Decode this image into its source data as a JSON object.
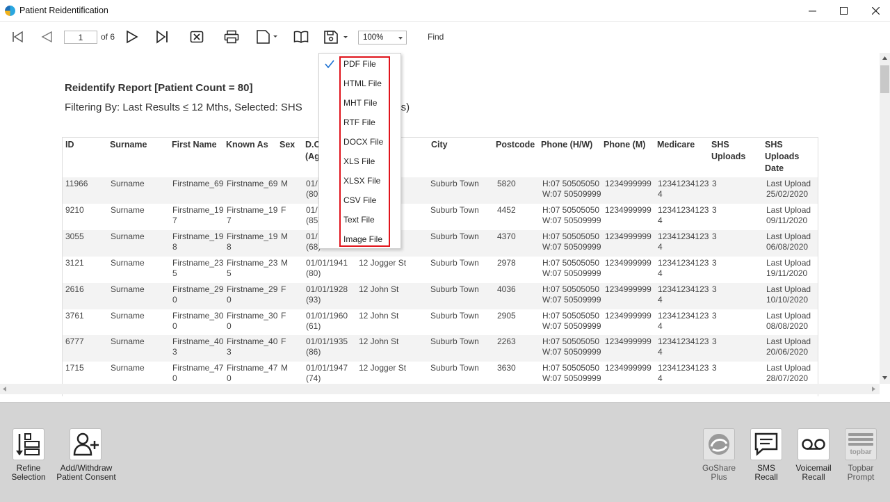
{
  "window": {
    "title": "Patient Reidentification",
    "min": "—",
    "max": "☐",
    "close": "✕"
  },
  "toolbar": {
    "page_value": "1",
    "page_of": "of 6",
    "zoom_value": "100%",
    "find_label": "Find"
  },
  "report": {
    "title": "Reidentify Report  [Patient Count = 80]",
    "filter": "Filtering By: Last Results ≤ 12 Mths, Selected: SHS",
    "filter_tail": "ads)"
  },
  "table": {
    "headers": [
      {
        "text": "ID"
      },
      {
        "text": "Surname"
      },
      {
        "text": "First Name"
      },
      {
        "text": "Known As"
      },
      {
        "text": "Sex"
      },
      {
        "text": "D.O",
        "line2": "(Ag"
      },
      {
        "text": ""
      },
      {
        "text": "City"
      },
      {
        "text": "Postcode"
      },
      {
        "text": "Phone (H/W)"
      },
      {
        "text": "Phone (M)"
      },
      {
        "text": "Medicare"
      },
      {
        "text": "SHS",
        "line2": "Uploads"
      },
      {
        "text": "SHS",
        "line2": "Uploads",
        "line3": "Date"
      }
    ],
    "rows": [
      {
        "id": "11966",
        "surname": "Surname",
        "first1": "Firstname_69",
        "first2": "",
        "known1": "Firstname_69",
        "known2": "",
        "sex": "M",
        "dob1": "01/",
        "dob2": "(80)",
        "addr": "t",
        "city": "Suburb Town",
        "postcode": "5820",
        "ph1": "H:07 50505050",
        "ph2": "W:07 50509999",
        "mob": "1234999999",
        "med1": "12341234123",
        "med2": "4",
        "up": "3",
        "ud1": "Last Upload",
        "ud2": "25/02/2020"
      },
      {
        "id": "9210",
        "surname": "Surname",
        "first1": "Firstname_19",
        "first2": "7",
        "known1": "Firstname_19",
        "known2": "7",
        "sex": "F",
        "dob1": "01/",
        "dob2": "(85)",
        "addr": "",
        "city": "Suburb Town",
        "postcode": "4452",
        "ph1": "H:07 50505050",
        "ph2": "W:07 50509999",
        "mob": "1234999999",
        "med1": "12341234123",
        "med2": "4",
        "up": "3",
        "ud1": "Last Upload",
        "ud2": "09/11/2020"
      },
      {
        "id": "3055",
        "surname": "Surname",
        "first1": "Firstname_19",
        "first2": "8",
        "known1": "Firstname_19",
        "known2": "8",
        "sex": "M",
        "dob1": "01/",
        "dob2": "(68)",
        "addr": "t",
        "city": "Suburb Town",
        "postcode": "4370",
        "ph1": "H:07 50505050",
        "ph2": "W:07 50509999",
        "mob": "1234999999",
        "med1": "12341234123",
        "med2": "4",
        "up": "3",
        "ud1": "Last Upload",
        "ud2": "06/08/2020"
      },
      {
        "id": "3121",
        "surname": "Surname",
        "first1": "Firstname_23",
        "first2": "5",
        "known1": "Firstname_23",
        "known2": "5",
        "sex": "M",
        "dob1": "01/01/1941",
        "dob2": "(80)",
        "addr": "12 Jogger St",
        "city": "Suburb Town",
        "postcode": "2978",
        "ph1": "H:07 50505050",
        "ph2": "W:07 50509999",
        "mob": "1234999999",
        "med1": "12341234123",
        "med2": "4",
        "up": "3",
        "ud1": "Last Upload",
        "ud2": "19/11/2020"
      },
      {
        "id": "2616",
        "surname": "Surname",
        "first1": "Firstname_29",
        "first2": "0",
        "known1": "Firstname_29",
        "known2": "0",
        "sex": "F",
        "dob1": "01/01/1928",
        "dob2": "(93)",
        "addr": "12 John St",
        "city": "Suburb Town",
        "postcode": "4036",
        "ph1": "H:07 50505050",
        "ph2": "W:07 50509999",
        "mob": "1234999999",
        "med1": "12341234123",
        "med2": "4",
        "up": "3",
        "ud1": "Last Upload",
        "ud2": "10/10/2020"
      },
      {
        "id": "3761",
        "surname": "Surname",
        "first1": "Firstname_30",
        "first2": "0",
        "known1": "Firstname_30",
        "known2": "0",
        "sex": "F",
        "dob1": "01/01/1960",
        "dob2": "(61)",
        "addr": "12 John St",
        "city": "Suburb Town",
        "postcode": "2905",
        "ph1": "H:07 50505050",
        "ph2": "W:07 50509999",
        "mob": "1234999999",
        "med1": "12341234123",
        "med2": "4",
        "up": "3",
        "ud1": "Last Upload",
        "ud2": "08/08/2020"
      },
      {
        "id": "6777",
        "surname": "Surname",
        "first1": "Firstname_40",
        "first2": "3",
        "known1": "Firstname_40",
        "known2": "3",
        "sex": "F",
        "dob1": "01/01/1935",
        "dob2": "(86)",
        "addr": "12 John St",
        "city": "Suburb Town",
        "postcode": "2263",
        "ph1": "H:07 50505050",
        "ph2": "W:07 50509999",
        "mob": "1234999999",
        "med1": "12341234123",
        "med2": "4",
        "up": "3",
        "ud1": "Last Upload",
        "ud2": "20/06/2020"
      },
      {
        "id": "1715",
        "surname": "Surname",
        "first1": "Firstname_47",
        "first2": "0",
        "known1": "Firstname_47",
        "known2": "0",
        "sex": "M",
        "dob1": "01/01/1947",
        "dob2": "(74)",
        "addr": "12 Jogger St",
        "city": "Suburb Town",
        "postcode": "3630",
        "ph1": "H:07 50505050",
        "ph2": "W:07 50509999",
        "mob": "1234999999",
        "med1": "12341234123",
        "med2": "4",
        "up": "3",
        "ud1": "Last Upload",
        "ud2": "28/07/2020"
      }
    ]
  },
  "save_menu": {
    "items": [
      "PDF File",
      "HTML File",
      "MHT File",
      "RTF File",
      "DOCX File",
      "XLS File",
      "XLSX File",
      "CSV File",
      "Text File",
      "Image File"
    ],
    "checked_index": 0,
    "highlight_color": "#e0131b"
  },
  "bottom": {
    "buttons": [
      {
        "label1": "Refine",
        "label2": "Selection"
      },
      {
        "label1": "Add/Withdraw",
        "label2": "Patient Consent"
      },
      {
        "label1": "GoShare",
        "label2": "Plus"
      },
      {
        "label1": "SMS",
        "label2": "Recall"
      },
      {
        "label1": "Voicemail",
        "label2": "Recall"
      },
      {
        "label1": "Topbar",
        "label2": "Prompt"
      }
    ],
    "topbar_logo_text": "topbar"
  }
}
